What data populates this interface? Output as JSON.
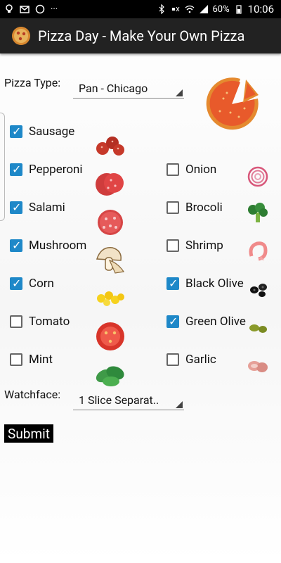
{
  "status": {
    "battery": "60%",
    "time": "10:06"
  },
  "app": {
    "title": "Pizza Day - Make Your Own Pizza"
  },
  "form": {
    "pizza_type_label": "Pizza Type:",
    "pizza_type_value": "Pan - Chicago",
    "watchface_label": "Watchface:",
    "watchface_value": "1 Slice Separat..",
    "submit_label": "Submit"
  },
  "left_toppings": [
    {
      "label": "Sausage",
      "checked": true
    },
    {
      "label": "Pepperoni",
      "checked": true
    },
    {
      "label": "Salami",
      "checked": true
    },
    {
      "label": "Mushroom",
      "checked": true
    },
    {
      "label": "Corn",
      "checked": true
    },
    {
      "label": "Tomato",
      "checked": false
    },
    {
      "label": "Mint",
      "checked": false
    }
  ],
  "right_toppings": [
    {
      "label": "Onion",
      "checked": false
    },
    {
      "label": "Brocoli",
      "checked": false
    },
    {
      "label": "Shrimp",
      "checked": false
    },
    {
      "label": "Black Olive",
      "checked": true
    },
    {
      "label": "Green Olive",
      "checked": true
    },
    {
      "label": "Garlic",
      "checked": false
    }
  ]
}
